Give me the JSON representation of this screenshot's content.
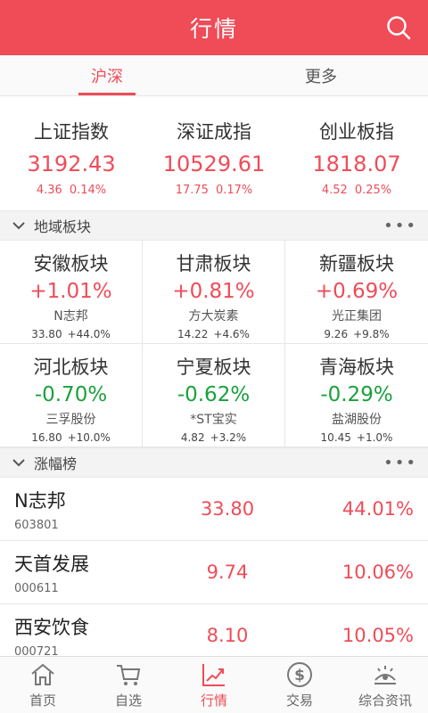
{
  "header": {
    "title": "行情"
  },
  "tabs": [
    {
      "label": "沪深",
      "active": true
    },
    {
      "label": "更多",
      "active": false
    }
  ],
  "indices": [
    {
      "name": "上证指数",
      "value": "3192.43",
      "change": "4.36",
      "pct": "0.14%"
    },
    {
      "name": "深证成指",
      "value": "10529.61",
      "change": "17.75",
      "pct": "0.17%"
    },
    {
      "name": "创业板指",
      "value": "1818.07",
      "change": "4.52",
      "pct": "0.25%"
    }
  ],
  "region_section": {
    "title": "地域板块",
    "more": "•••"
  },
  "regions": [
    {
      "name": "安徽板块",
      "pct": "+1.01%",
      "trend": "up",
      "stock": "N志邦",
      "price": "33.80",
      "stock_pct": "+44.0%"
    },
    {
      "name": "甘肃板块",
      "pct": "+0.81%",
      "trend": "up",
      "stock": "方大炭素",
      "price": "14.22",
      "stock_pct": "+4.6%"
    },
    {
      "name": "新疆板块",
      "pct": "+0.69%",
      "trend": "up",
      "stock": "光正集团",
      "price": "9.26",
      "stock_pct": "+9.8%"
    },
    {
      "name": "河北板块",
      "pct": "-0.70%",
      "trend": "down",
      "stock": "三孚股份",
      "price": "16.80",
      "stock_pct": "+10.0%"
    },
    {
      "name": "宁夏板块",
      "pct": "-0.62%",
      "trend": "down",
      "stock": "*ST宝实",
      "price": "4.82",
      "stock_pct": "+3.2%"
    },
    {
      "name": "青海板块",
      "pct": "-0.29%",
      "trend": "down",
      "stock": "盐湖股份",
      "price": "10.45",
      "stock_pct": "+1.0%"
    }
  ],
  "gainers_section": {
    "title": "涨幅榜",
    "more": "•••"
  },
  "gainers": [
    {
      "name": "N志邦",
      "code": "603801",
      "price": "33.80",
      "pct": "44.01%"
    },
    {
      "name": "天首发展",
      "code": "000611",
      "price": "9.74",
      "pct": "10.06%"
    },
    {
      "name": "西安饮食",
      "code": "000721",
      "price": "8.10",
      "pct": "10.05%"
    }
  ],
  "bottom_nav": [
    {
      "label": "首页",
      "icon": "home-icon",
      "active": false
    },
    {
      "label": "自选",
      "icon": "cart-icon",
      "active": false
    },
    {
      "label": "行情",
      "icon": "chart-trend-icon",
      "active": true
    },
    {
      "label": "交易",
      "icon": "dollar-icon",
      "active": false
    },
    {
      "label": "综合资讯",
      "icon": "news-icon",
      "active": false
    }
  ],
  "colors": {
    "brand": "#ef4c58",
    "up": "#ef4c58",
    "down": "#1aa13c"
  }
}
